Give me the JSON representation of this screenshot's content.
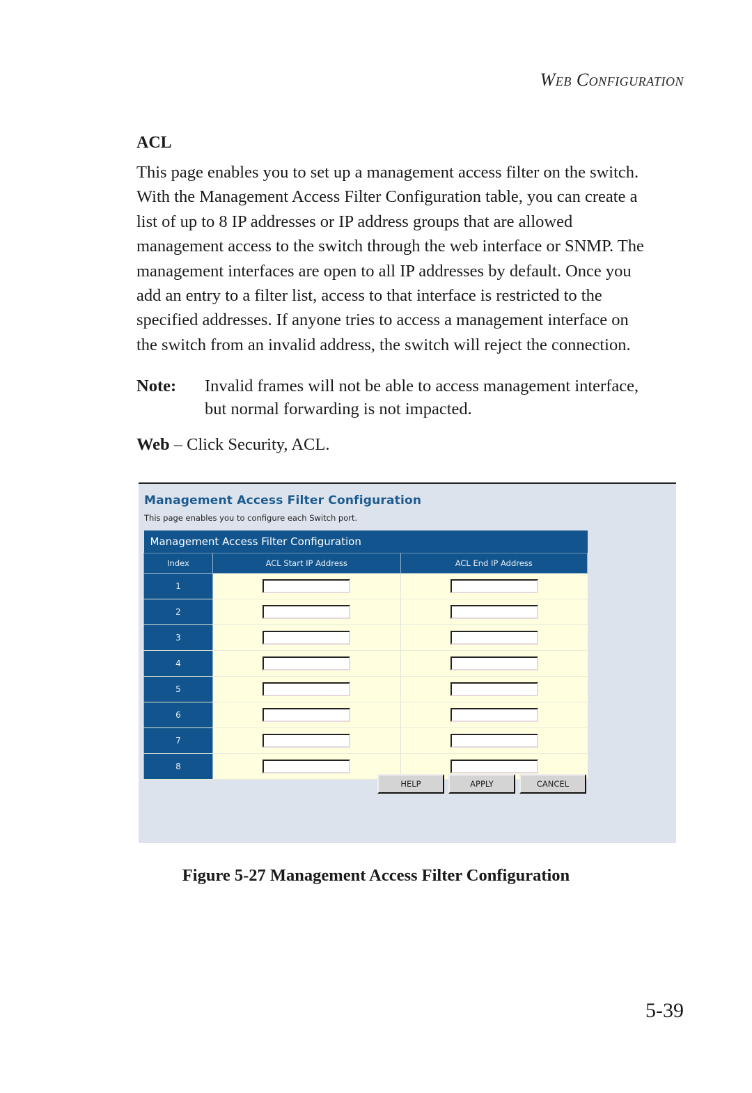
{
  "running_head": "Web Configuration",
  "section": {
    "title": "ACL",
    "body_lines": [
      "This page enables you to set up a management access filter on the switch.",
      "With the Management Access Filter Configuration table, you can create a",
      "list of up to 8 IP addresses or IP address groups that are allowed",
      "management access to the switch through the web interface or SNMP. The",
      "management interfaces are open to all IP addresses by default. Once you",
      "add an entry to a filter list, access to that interface is restricted to the",
      "specified addresses. If anyone tries to access a management interface on",
      "the switch from an invalid address, the switch will reject the connection."
    ]
  },
  "note": {
    "label": "Note:",
    "lines": [
      "Invalid frames will not be able to access management interface,",
      "but normal forwarding is not impacted."
    ]
  },
  "web_instruction": {
    "label": "Web",
    "text": " – Click Security, ACL."
  },
  "figure": {
    "page_title": "Management Access Filter Configuration",
    "page_subtitle": "This page enables you to configure each Switch port.",
    "table": {
      "caption": "Management Access Filter Configuration",
      "headers": [
        "Index",
        "ACL Start IP Address",
        "ACL End IP Address"
      ],
      "rows": [
        {
          "index": "1",
          "start_ip": "",
          "end_ip": ""
        },
        {
          "index": "2",
          "start_ip": "",
          "end_ip": ""
        },
        {
          "index": "3",
          "start_ip": "",
          "end_ip": ""
        },
        {
          "index": "4",
          "start_ip": "",
          "end_ip": ""
        },
        {
          "index": "5",
          "start_ip": "",
          "end_ip": ""
        },
        {
          "index": "6",
          "start_ip": "",
          "end_ip": ""
        },
        {
          "index": "7",
          "start_ip": "",
          "end_ip": ""
        },
        {
          "index": "8",
          "start_ip": "",
          "end_ip": ""
        }
      ]
    },
    "buttons": {
      "help": "HELP",
      "apply": "APPLY",
      "cancel": "CANCEL"
    },
    "colors": {
      "header_blue": "#12558e",
      "title_blue": "#1c5a8e",
      "row_yellow": "#ffffe0",
      "panel_bg": "#dce3ec"
    }
  },
  "figure_caption": "Figure 5-27  Management Access Filter Configuration",
  "page_number": "5-39"
}
